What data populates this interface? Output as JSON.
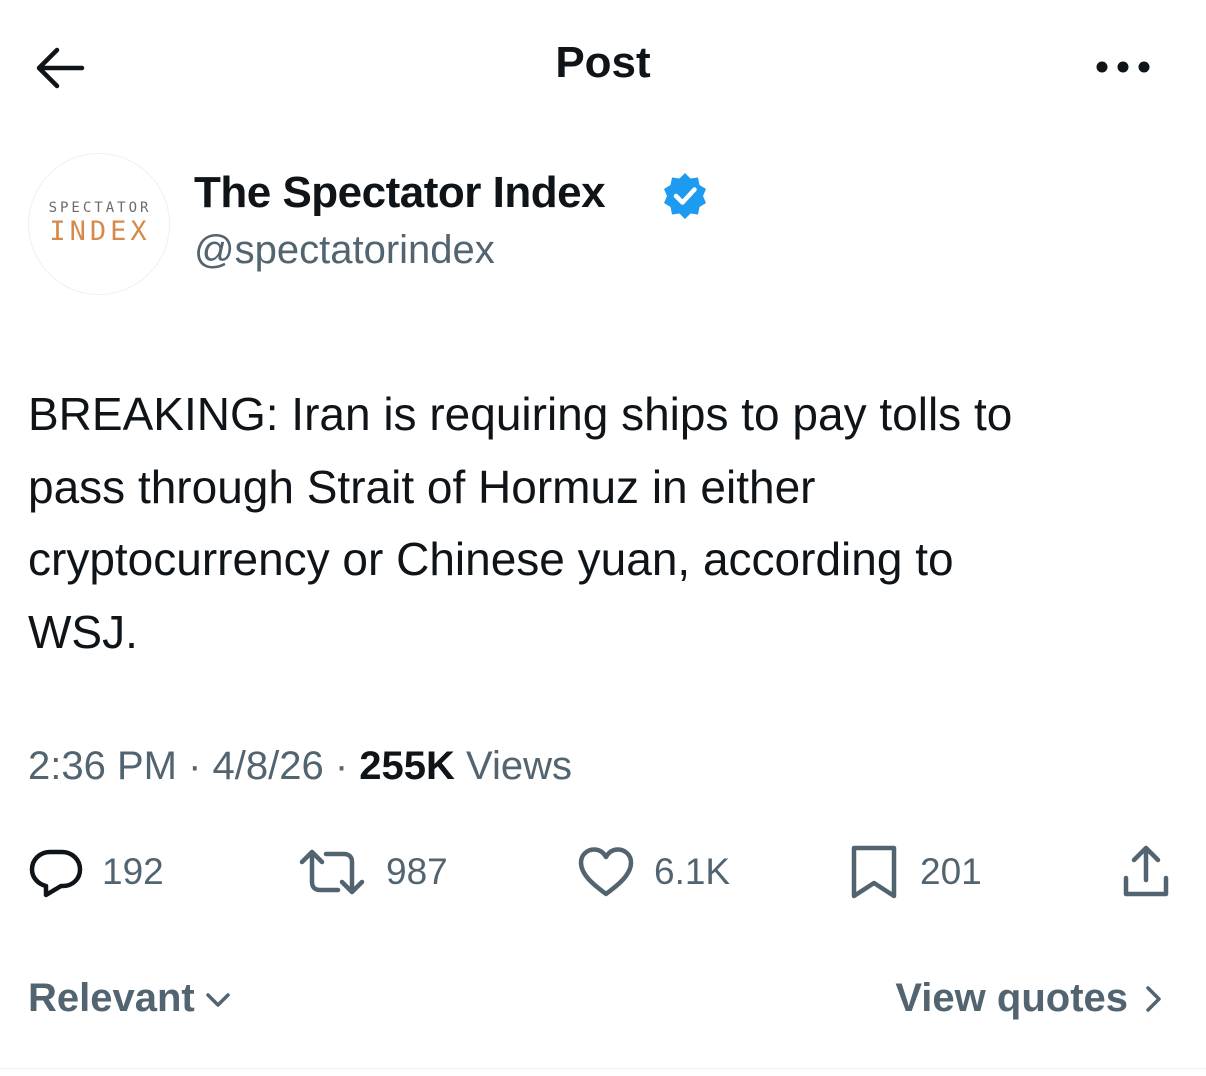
{
  "header": {
    "title": "Post",
    "back_icon": "arrow-left-icon",
    "more_icon": "more-horizontal-icon"
  },
  "author": {
    "avatar_line1": "SPECTATOR",
    "avatar_line2": "INDEX",
    "display_name": "The Spectator Index",
    "verified": true,
    "verified_color": "#1d9bf0",
    "handle": "@spectatorindex"
  },
  "post": {
    "text": "BREAKING: Iran is requiring ships to pay tolls to\npass through Strait of Hormuz in either\ncryptocurrency or Chinese yuan, according to\nWSJ.",
    "time": "2:36 PM",
    "date": "4/8/26",
    "views_count": "255K",
    "views_label": "Views"
  },
  "actions": {
    "reply": {
      "icon": "reply-icon",
      "count": "192"
    },
    "repost": {
      "icon": "repost-icon",
      "count": "987"
    },
    "like": {
      "icon": "heart-icon",
      "count": "6.1K"
    },
    "bookmark": {
      "icon": "bookmark-icon",
      "count": "201"
    },
    "share": {
      "icon": "share-icon"
    }
  },
  "footer": {
    "sort_label": "Relevant",
    "view_quotes_label": "View quotes"
  },
  "colors": {
    "text": "#0f1419",
    "secondary": "#536471",
    "accent": "#1d9bf0"
  }
}
